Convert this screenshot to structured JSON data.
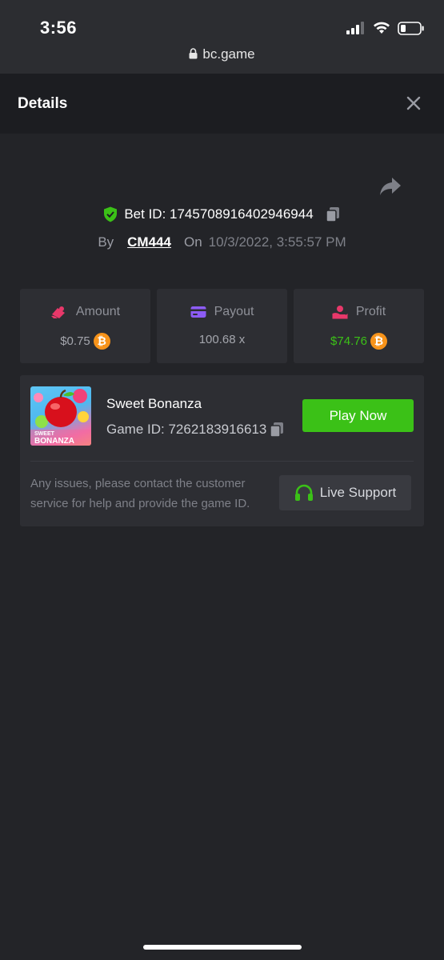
{
  "status_bar": {
    "time": "3:56",
    "url": "bc.game",
    "icons": [
      "signal-icon",
      "wifi-icon",
      "battery-icon",
      "lock-icon"
    ]
  },
  "header": {
    "title": "Details",
    "close_icon": "close-icon"
  },
  "bet": {
    "share_icon": "share-icon",
    "bet_id_label": "Bet ID: 1745708916402946944",
    "by_label": "By",
    "user": "CM444",
    "on_label": "On",
    "date": "10/3/2022, 3:55:57 PM"
  },
  "stats": {
    "amount": {
      "label": "Amount",
      "value": "$0.75",
      "icon": "amount-icon",
      "currency_icon": "bitcoin-icon"
    },
    "payout": {
      "label": "Payout",
      "value": "100.68 x",
      "icon": "payout-card-icon"
    },
    "profit": {
      "label": "Profit",
      "value": "$74.76",
      "icon": "profit-icon",
      "currency_icon": "bitcoin-icon"
    }
  },
  "game": {
    "name": "Sweet Bonanza",
    "game_id_label": "Game ID: 7262183916613",
    "thumb_text_1": "SWEET",
    "thumb_text_2": "BONANZA",
    "play_label": "Play Now",
    "support_text": "Any issues, please contact the customer service for help and provide the game ID.",
    "support_label": "Live Support"
  },
  "colors": {
    "background": "#232428",
    "card": "#2d2e33",
    "accent_green": "#3bc117",
    "bitcoin_orange": "#f7931a"
  }
}
